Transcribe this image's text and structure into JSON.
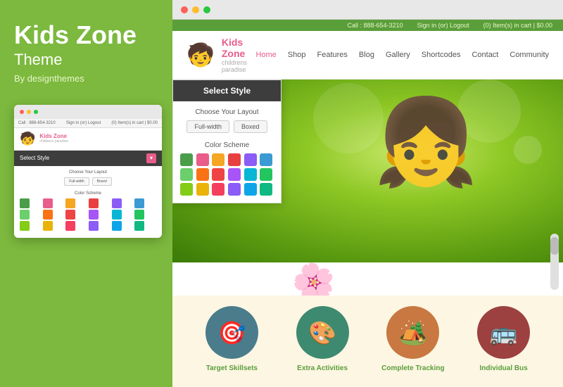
{
  "left": {
    "title": "Kids Zone",
    "subtitle": "Theme",
    "by": "By designthemes"
  },
  "mini_browser": {
    "dots": [
      "red",
      "yellow",
      "green"
    ],
    "topbar": {
      "call": "Call : 888-654-3210",
      "signin": "Sign in (or) Logout",
      "cart": "(0) Item(s) in cart | $0.00"
    },
    "logo_text": "Kids Zone",
    "logo_tagline": "childrens paradise",
    "select_style_label": "Select Style",
    "choose_layout": "Choose Your Layout",
    "layout_options": [
      "Full-width",
      "Boxed"
    ],
    "color_scheme": "Color Scheme",
    "colors": [
      "#4a9e4a",
      "#e85d8a",
      "#f5a623",
      "#e84040",
      "#8b5cf6",
      "#3b9ad4",
      "#6bcf6b",
      "#f97316",
      "#ef4444",
      "#a855f7",
      "#06b6d4",
      "#22c55e",
      "#84cc16",
      "#eab308",
      "#f43f5e",
      "#8b5cf6",
      "#0ea5e9",
      "#10b981"
    ]
  },
  "browser": {
    "dots": [
      "red",
      "yellow",
      "green"
    ]
  },
  "site": {
    "topbar": {
      "call": "Call : 888-654-3210",
      "signin": "Sign in (or) Logout",
      "cart": "(0) Item(s) in cart | $0.00"
    },
    "logo_text": "Kids Zone",
    "logo_tagline": "childrens paradise",
    "nav": [
      "Home",
      "Shop",
      "Features",
      "Blog",
      "Gallery",
      "Shortcodes",
      "Contact",
      "Community"
    ]
  },
  "popup": {
    "title": "Select Style",
    "layout_title": "Choose Your Layout",
    "layout_options": [
      "Full-width",
      "Boxed"
    ],
    "color_title": "Color Scheme",
    "colors": [
      "#4a9e4a",
      "#e85d8a",
      "#f5a623",
      "#e84040",
      "#8b5cf6",
      "#3b9ad4",
      "#6bcf6b",
      "#f97316",
      "#ef4444",
      "#a855f7",
      "#06b6d4",
      "#22c55e",
      "#84cc16",
      "#eab308",
      "#f43f5e",
      "#8b5cf6",
      "#0ea5e9",
      "#10b981"
    ]
  },
  "icons": [
    {
      "label": "Target Skillsets",
      "color": "#4a7c8c",
      "emoji": "🎯"
    },
    {
      "label": "Extra Activities",
      "color": "#3d8a70",
      "emoji": "🎨"
    },
    {
      "label": "Complete Tracking",
      "color": "#c87840",
      "emoji": "🏕️"
    },
    {
      "label": "Individual Bus",
      "color": "#9c4040",
      "emoji": "🚌"
    }
  ]
}
